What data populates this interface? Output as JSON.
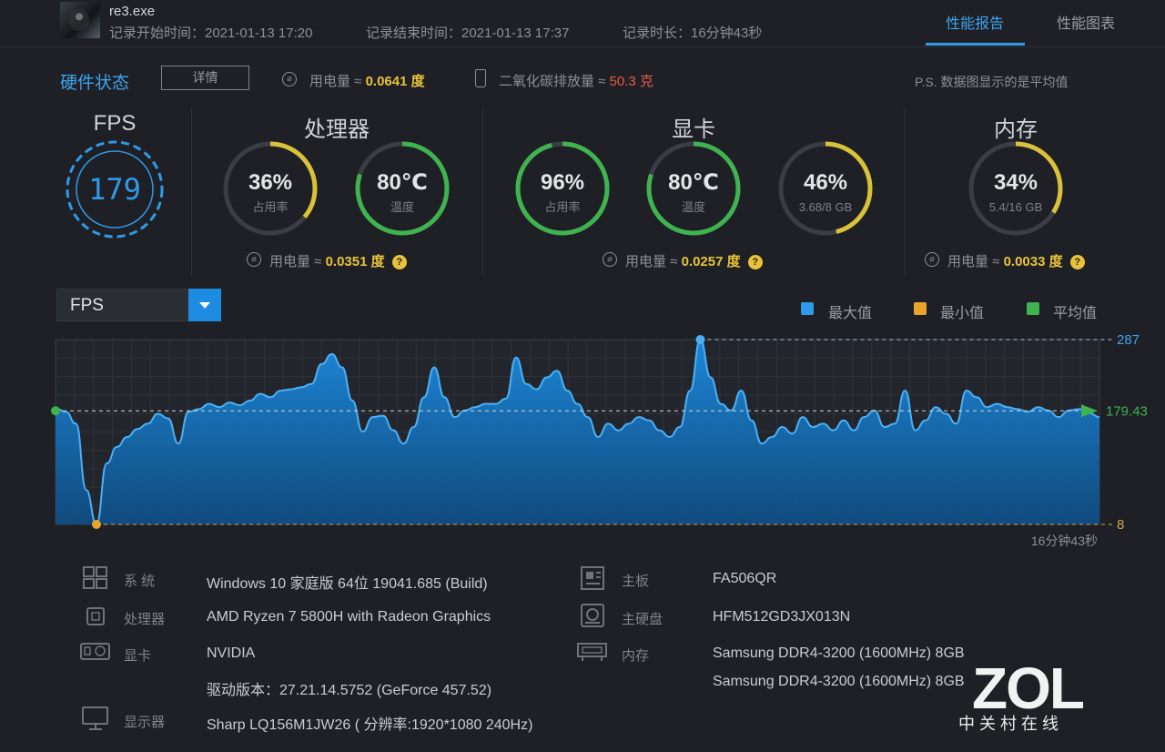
{
  "header": {
    "process_name": "re3.exe",
    "start_time": "记录开始时间：2021-01-13 17:20",
    "end_time": "记录结束时间：2021-01-13 17:37",
    "duration": "记录时长：16分钟43秒",
    "tabs": [
      {
        "label": "性能报告",
        "active": true
      },
      {
        "label": "性能图表",
        "active": false
      }
    ]
  },
  "hardware": {
    "title": "硬件状态",
    "detail_button": "详情",
    "power_label": "用电量 ≈",
    "power_value": "0.0641 度",
    "co2_label": "二氧化碳排放量 ≈",
    "co2_value": "50.3 克",
    "ps_note": "P.S. 数据图显示的是平均值"
  },
  "fps": {
    "title": "FPS",
    "value": "179"
  },
  "cpu": {
    "title": "处理器",
    "usage": {
      "value": "36%",
      "label": "占用率",
      "fraction": 0.36
    },
    "temp": {
      "value": "80℃",
      "label": "温度",
      "fraction": 0.8
    },
    "power_label": "用电量 ≈",
    "power_value": "0.0351 度"
  },
  "gpu": {
    "title": "显卡",
    "usage": {
      "value": "96%",
      "label": "占用率",
      "fraction": 0.96
    },
    "temp": {
      "value": "80℃",
      "label": "温度",
      "fraction": 0.8
    },
    "vram": {
      "value": "46%",
      "label": "3.68/8 GB",
      "fraction": 0.46
    },
    "power_label": "用电量 ≈",
    "power_value": "0.0257 度"
  },
  "memory": {
    "title": "内存",
    "usage": {
      "value": "34%",
      "label": "5.4/16 GB",
      "fraction": 0.34
    },
    "power_label": "用电量 ≈",
    "power_value": "0.0033 度"
  },
  "colors": {
    "accent": "#2f9ae8",
    "gauge_yellow": "#d9c23a",
    "gauge_green": "#3fb34f",
    "gauge_track": "#3a3d44",
    "max": "#2f9ae8",
    "min": "#e8a52a",
    "avg": "#3fb34f"
  },
  "chart_selector": {
    "value": "FPS"
  },
  "legend": [
    {
      "label": "最大值",
      "color": "#2f9ae8"
    },
    {
      "label": "最小值",
      "color": "#e8a52a"
    },
    {
      "label": "平均值",
      "color": "#3fb34f"
    }
  ],
  "chart_data": {
    "type": "area",
    "y_max_label": "287",
    "y_avg_label": "179.43",
    "y_min_label": "8",
    "x_end_label": "16分钟43秒",
    "ylim": [
      8,
      287
    ],
    "max": 287,
    "min": 8,
    "avg": 179.43,
    "values": [
      183,
      178,
      160,
      60,
      8,
      100,
      125,
      140,
      152,
      160,
      175,
      168,
      130,
      178,
      182,
      190,
      185,
      192,
      188,
      195,
      205,
      200,
      210,
      212,
      215,
      220,
      250,
      265,
      245,
      195,
      148,
      170,
      172,
      150,
      130,
      155,
      200,
      245,
      200,
      170,
      180,
      185,
      190,
      190,
      198,
      260,
      220,
      212,
      230,
      240,
      210,
      190,
      170,
      140,
      160,
      150,
      160,
      170,
      165,
      150,
      140,
      155,
      210,
      287,
      230,
      190,
      180,
      210,
      165,
      130,
      140,
      155,
      145,
      170,
      155,
      160,
      150,
      165,
      150,
      170,
      180,
      155,
      160,
      210,
      150,
      165,
      185,
      175,
      160,
      210,
      200,
      185,
      190,
      185,
      182,
      178,
      185,
      180,
      170,
      180,
      182,
      176,
      170
    ]
  },
  "system": {
    "items_left": [
      {
        "key": "系  统",
        "value": "Windows 10 家庭版 64位   19041.685 (Build)",
        "icon": "windows-icon"
      },
      {
        "key": "处理器",
        "value": "AMD Ryzen 7 5800H with Radeon Graphics",
        "icon": "cpu-icon"
      },
      {
        "key": "显卡",
        "value": "NVIDIA",
        "icon": "gpu-icon"
      },
      {
        "key": "",
        "value": "驱动版本：27.21.14.5752 (GeForce 457.52)",
        "icon": ""
      },
      {
        "key": "显示器",
        "value": "Sharp LQ156M1JW26 ( 分辨率:1920*1080 240Hz)",
        "icon": "monitor-icon"
      }
    ],
    "items_right": [
      {
        "key": "主板",
        "value": "FA506QR",
        "icon": "motherboard-icon"
      },
      {
        "key": "主硬盘",
        "value": "HFM512GD3JX013N",
        "icon": "disk-icon"
      },
      {
        "key": "内存",
        "value": "Samsung DDR4-3200 (1600MHz) 8GB",
        "icon": "memory-icon"
      },
      {
        "key": "",
        "value": "Samsung DDR4-3200 (1600MHz) 8GB",
        "icon": ""
      }
    ]
  },
  "watermark": {
    "logo": "ZOL",
    "sub": "中关村在线"
  }
}
